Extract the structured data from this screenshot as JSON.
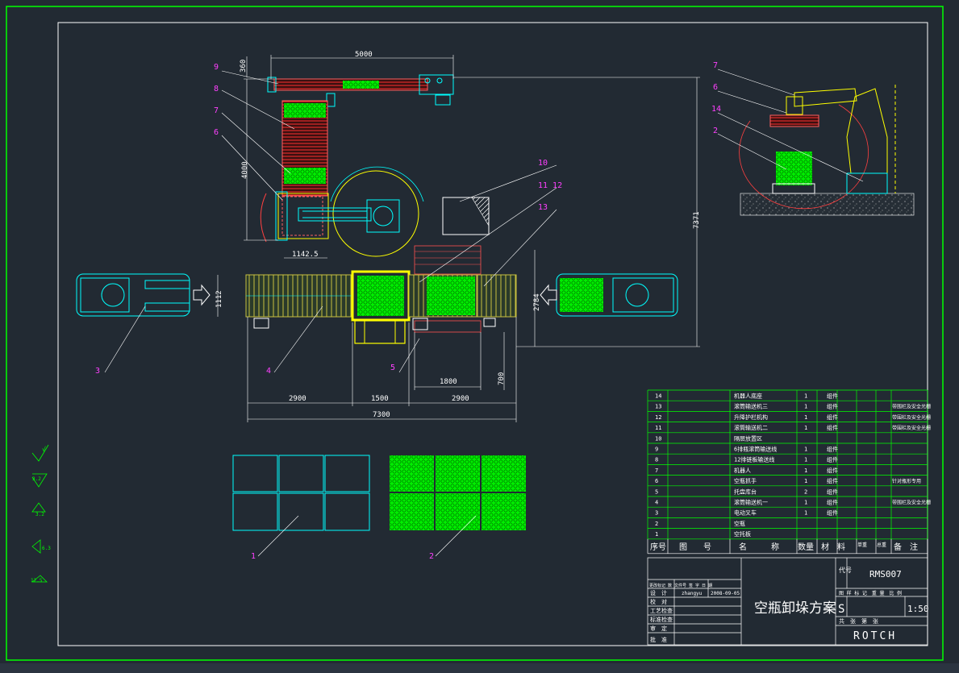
{
  "drawing": {
    "title": "空瓶卸垛方案",
    "drawing_no": "RMS007",
    "scale": "1:50",
    "stage_mark": "S",
    "company": "ROTCH",
    "designer": "zhangyu",
    "date": "2008-09-05",
    "colors": {
      "background": "#222a33",
      "frame": "#00ff00",
      "outline": "#00ffff",
      "pallet": "#00ff00",
      "balloon": "#ff40ff",
      "dimension": "#ffffff",
      "robot": "#ffff00",
      "conveyor": "#c8c040"
    }
  },
  "dimensions": {
    "top_width": "5000",
    "top_offset": "360",
    "vertical_left": "4000",
    "pitch": "1142.5",
    "overall_height": "7371",
    "line_height": "1112",
    "right_height": "2784",
    "width_1800": "1800",
    "height_700": "700",
    "seg_2900a": "2900",
    "seg_1500": "1500",
    "seg_2900b": "2900",
    "total_length": "7300"
  },
  "balloons": {
    "b1": "1",
    "b2": "2",
    "b3": "3",
    "b4": "4",
    "b5": "5",
    "b6": "6",
    "b7": "7",
    "b8": "8",
    "b9": "9",
    "b10": "10",
    "b11_12": "11 12",
    "b13": "13",
    "side_b7": "7",
    "side_b6": "6",
    "side_b14": "14",
    "side_b2": "2"
  },
  "bom": {
    "rows": [
      {
        "no": "14",
        "name": "机器人底座",
        "qty": "1",
        "material": "组件",
        "note": ""
      },
      {
        "no": "13",
        "name": "滚筒输送机三",
        "qty": "1",
        "material": "组件",
        "note": "带围栏及安全光栅"
      },
      {
        "no": "12",
        "name": "升降护栏机构",
        "qty": "1",
        "material": "组件",
        "note": "带围栏及安全光栅"
      },
      {
        "no": "11",
        "name": "滚筒输送机二",
        "qty": "1",
        "material": "组件",
        "note": "带围栏及安全光栅"
      },
      {
        "no": "10",
        "name": "隔层放置区",
        "qty": "",
        "material": "",
        "note": ""
      },
      {
        "no": "9",
        "name": "6排瓶滚筒输送线",
        "qty": "1",
        "material": "组件",
        "note": ""
      },
      {
        "no": "8",
        "name": "12排链板输送线",
        "qty": "1",
        "material": "组件",
        "note": ""
      },
      {
        "no": "7",
        "name": "机器人",
        "qty": "1",
        "material": "组件",
        "note": ""
      },
      {
        "no": "6",
        "name": "空瓶抓手",
        "qty": "1",
        "material": "组件",
        "note": "针对瓶形专用"
      },
      {
        "no": "5",
        "name": "托盘库台",
        "qty": "2",
        "material": "组件",
        "note": ""
      },
      {
        "no": "4",
        "name": "滚筒输送机一",
        "qty": "1",
        "material": "组件",
        "note": "带围栏及安全光栅"
      },
      {
        "no": "3",
        "name": "电动叉车",
        "qty": "1",
        "material": "组件",
        "note": ""
      },
      {
        "no": "2",
        "name": "空瓶",
        "qty": "",
        "material": "",
        "note": ""
      },
      {
        "no": "1",
        "name": "空托板",
        "qty": "",
        "material": "",
        "note": ""
      }
    ],
    "header": {
      "no": "序号",
      "drawing": "图　　号",
      "name": "名　　　称",
      "qty": "数量",
      "material": "材　料",
      "unit": "单重",
      "total": "总重",
      "note": "备　注"
    }
  },
  "title_block": {
    "code_label": "代号",
    "rev_header": "更改标记 数 文件号 签 字 日 期",
    "labels": [
      "设　计",
      "校　对",
      "工艺检查",
      "标准检查",
      "审　定",
      "批　准"
    ],
    "stage_header": "图 样 标 记　重 量　比 例",
    "sheet_row": "共　张　第　张"
  },
  "symbols": [
    "√",
    "3.2",
    "3.2",
    "6.3",
    "12.5"
  ]
}
